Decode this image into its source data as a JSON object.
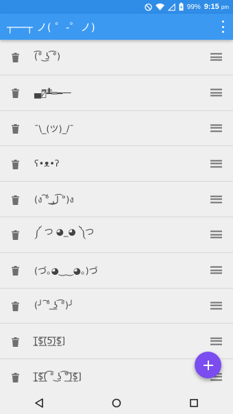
{
  "status_bar": {
    "battery_percent": "99%",
    "time": "9:15",
    "time_suffix": "pm",
    "icons": [
      "do-not-disturb-icon",
      "wifi-icon",
      "signal-icon",
      "battery-charging-icon"
    ]
  },
  "app_bar": {
    "title": "┬──┬ ノ( ゜-゜ノ)",
    "menu_icon": "overflow-menu-icon"
  },
  "list": {
    "items": [
      {
        "text": "(͡° ͜ʖ ͡°)"
      },
      {
        "text": "▄︻̷̿┻̿═━一"
      },
      {
        "text": "¯\\_(ツ)_/¯"
      },
      {
        "text": "ʕ•ᴥ•ʔ"
      },
      {
        "text": "(ง ͠° ͟ل͜ ͡°)ง"
      },
      {
        "text": "༼ つ ◕_◕ ༽つ"
      },
      {
        "text": "(づ｡◕‿‿◕｡)づ"
      },
      {
        "text": "(╯ ͠° ͟ʖ ͡°)╯"
      },
      {
        "text": "[̲̅$̲̅(̲̅5̲̅)̲̅$̲̅]"
      },
      {
        "text": "[̲̅$̲̅(̲̅ ͡° ͜ʖ ͡°̲̅)̲̅$̲̅]"
      }
    ],
    "row_icon_left": "trash-icon",
    "row_icon_right": "drag-handle-icon"
  },
  "fab": {
    "icon": "plus-icon",
    "color": "#7b4cf0"
  },
  "nav": {
    "icons": [
      "back-icon",
      "home-icon",
      "recents-icon"
    ]
  },
  "colors": {
    "app_bar": "#3b99f2",
    "status_bar": "#2f8de8",
    "background": "#efefef"
  }
}
